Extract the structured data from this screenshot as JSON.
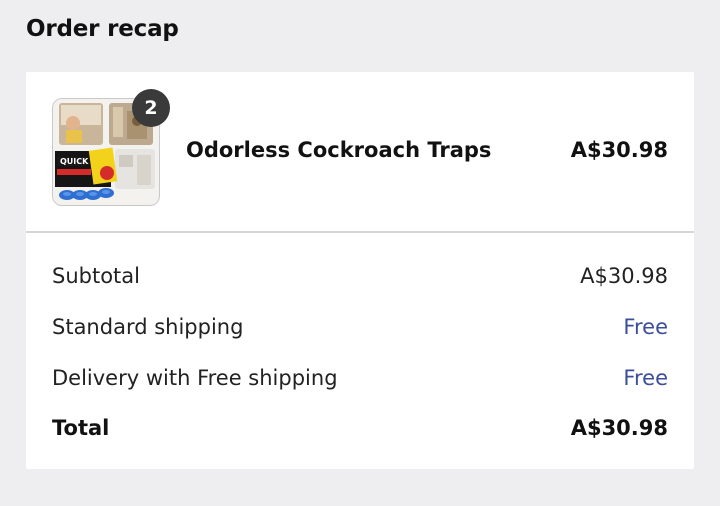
{
  "title": "Order recap",
  "item": {
    "name": "Odorless Cockroach Traps",
    "price": "A$30.98",
    "quantity": "2",
    "thumbnail_icon": "product-image",
    "package_brand_text": "QUICK"
  },
  "summary": {
    "subtotal_label": "Subtotal",
    "subtotal_value": "A$30.98",
    "shipping_label": "Standard shipping",
    "shipping_value": "Free",
    "delivery_label": "Delivery with Free shipping",
    "delivery_value": "Free",
    "total_label": "Total",
    "total_value": "A$30.98"
  },
  "colors": {
    "free_text": "#3b4e9a",
    "badge": "#3a3a3a",
    "background": "#eeeef0"
  }
}
